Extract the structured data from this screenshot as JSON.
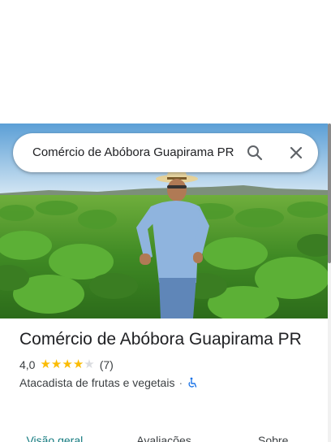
{
  "search": {
    "query": "Comércio de Abóbora Guapirama PR"
  },
  "place": {
    "title": "Comércio de Abóbora Guapirama PR",
    "rating": "4,0",
    "stars_filled": 4,
    "stars_total": 5,
    "review_count": "(7)",
    "category": "Atacadista de frutas e vegetais",
    "separator": "·"
  },
  "tabs": [
    {
      "label": "Visão geral",
      "active": true
    },
    {
      "label": "Avaliações",
      "active": false
    },
    {
      "label": "Sobre",
      "active": false
    }
  ],
  "icons": {
    "search": "search-icon",
    "close": "close-icon",
    "accessibility": "wheelchair-icon"
  },
  "colors": {
    "star": "#fbbc04",
    "star_empty": "#dadce0",
    "active_tab": "#137a7f",
    "accessibility": "#1a73e8"
  }
}
